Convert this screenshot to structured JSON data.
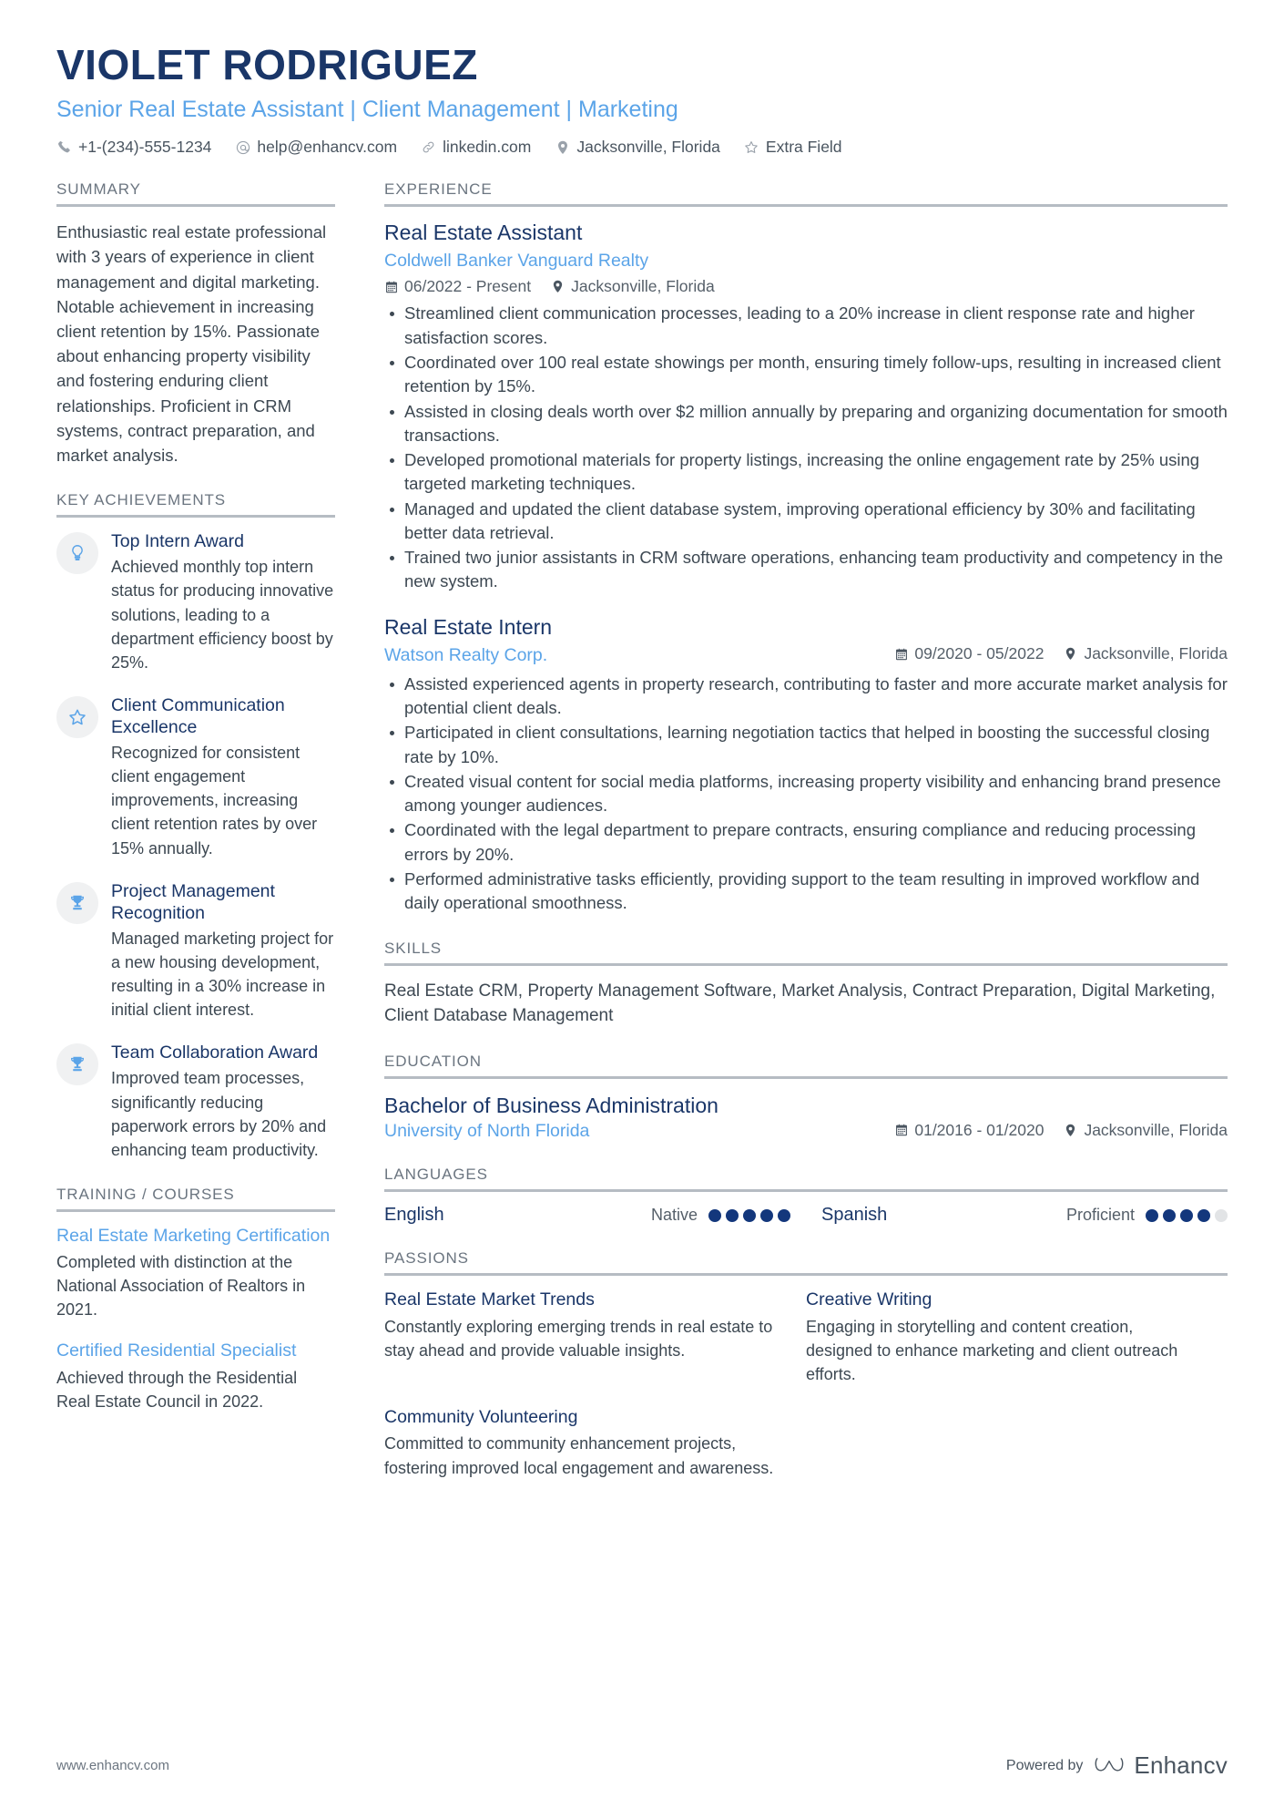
{
  "header": {
    "name": "VIOLET RODRIGUEZ",
    "headline": "Senior Real Estate Assistant | Client Management | Marketing",
    "contacts": [
      {
        "icon": "phone-icon",
        "text": "+1-(234)-555-1234"
      },
      {
        "icon": "email-icon",
        "text": "help@enhancv.com"
      },
      {
        "icon": "link-icon",
        "text": "linkedin.com"
      },
      {
        "icon": "location-pin-icon",
        "text": "Jacksonville, Florida"
      },
      {
        "icon": "star-icon",
        "text": "Extra Field"
      }
    ]
  },
  "summary": {
    "title": "SUMMARY",
    "text": "Enthusiastic real estate professional with 3 years of experience in client management and digital marketing. Notable achievement in increasing client retention by 15%. Passionate about enhancing property visibility and fostering enduring client relationships. Proficient in CRM systems, contract preparation, and market analysis."
  },
  "key_achievements": {
    "title": "KEY ACHIEVEMENTS",
    "items": [
      {
        "icon": "lightbulb-icon",
        "title": "Top Intern Award",
        "desc": "Achieved monthly top intern status for producing innovative solutions, leading to a department efficiency boost by 25%."
      },
      {
        "icon": "star-outline-icon",
        "title": "Client Communication Excellence",
        "desc": "Recognized for consistent client engagement improvements, increasing client retention rates by over 15% annually."
      },
      {
        "icon": "trophy-icon",
        "title": "Project Management Recognition",
        "desc": "Managed marketing project for a new housing development, resulting in a 30% increase in initial client interest."
      },
      {
        "icon": "trophy-icon",
        "title": "Team Collaboration Award",
        "desc": "Improved team processes, significantly reducing paperwork errors by 20% and enhancing team productivity."
      }
    ]
  },
  "training": {
    "title": "TRAINING / COURSES",
    "items": [
      {
        "title": "Real Estate Marketing Certification",
        "desc": "Completed with distinction at the National Association of Realtors in 2021."
      },
      {
        "title": "Certified Residential Specialist",
        "desc": "Achieved through the Residential Real Estate Council in 2022."
      }
    ]
  },
  "experience": {
    "title": "EXPERIENCE",
    "jobs": [
      {
        "title": "Real Estate Assistant",
        "company": "Coldwell Banker Vanguard Realty",
        "date": "06/2022 - Present",
        "location": "Jacksonville, Florida",
        "meta_inline": false,
        "bullets": [
          "Streamlined client communication processes, leading to a 20% increase in client response rate and higher satisfaction scores.",
          "Coordinated over 100 real estate showings per month, ensuring timely follow-ups, resulting in increased client retention by 15%.",
          "Assisted in closing deals worth over $2 million annually by preparing and organizing documentation for smooth transactions.",
          "Developed promotional materials for property listings, increasing the online engagement rate by 25% using targeted marketing techniques.",
          "Managed and updated the client database system, improving operational efficiency by 30% and facilitating better data retrieval.",
          "Trained two junior assistants in CRM software operations, enhancing team productivity and competency in the new system."
        ]
      },
      {
        "title": "Real Estate Intern",
        "company": "Watson Realty Corp.",
        "date": "09/2020 - 05/2022",
        "location": "Jacksonville, Florida",
        "meta_inline": true,
        "bullets": [
          "Assisted experienced agents in property research, contributing to faster and more accurate market analysis for potential client deals.",
          "Participated in client consultations, learning negotiation tactics that helped in boosting the successful closing rate by 10%.",
          "Created visual content for social media platforms, increasing property visibility and enhancing brand presence among younger audiences.",
          "Coordinated with the legal department to prepare contracts, ensuring compliance and reducing processing errors by 20%.",
          "Performed administrative tasks efficiently, providing support to the team resulting in improved workflow and daily operational smoothness."
        ]
      }
    ]
  },
  "skills": {
    "title": "SKILLS",
    "text": "Real Estate CRM, Property Management Software, Market Analysis, Contract Preparation, Digital Marketing, Client Database Management"
  },
  "education": {
    "title": "EDUCATION",
    "degree": "Bachelor of Business Administration",
    "school": "University of North Florida",
    "date": "01/2016 - 01/2020",
    "location": "Jacksonville, Florida"
  },
  "languages": {
    "title": "LANGUAGES",
    "items": [
      {
        "name": "English",
        "level": "Native",
        "filled": 5,
        "total": 5
      },
      {
        "name": "Spanish",
        "level": "Proficient",
        "filled": 4,
        "total": 5
      }
    ]
  },
  "passions": {
    "title": "PASSIONS",
    "items": [
      {
        "title": "Real Estate Market Trends",
        "desc": "Constantly exploring emerging trends in real estate to stay ahead and provide valuable insights."
      },
      {
        "title": "Creative Writing",
        "desc": "Engaging in storytelling and content creation, designed to enhance marketing and client outreach efforts."
      },
      {
        "title": "Community Volunteering",
        "desc": "Committed to community enhancement projects, fostering improved local engagement and awareness."
      }
    ]
  },
  "footer": {
    "website": "www.enhancv.com",
    "powered_by": "Powered by",
    "brand": "Enhancv"
  },
  "colors": {
    "navy": "#1a3668",
    "light_blue": "#5ba4e8",
    "dot_navy": "#13377c",
    "dot_off": "#e2e4e6",
    "rule": "#b6bcc3"
  }
}
